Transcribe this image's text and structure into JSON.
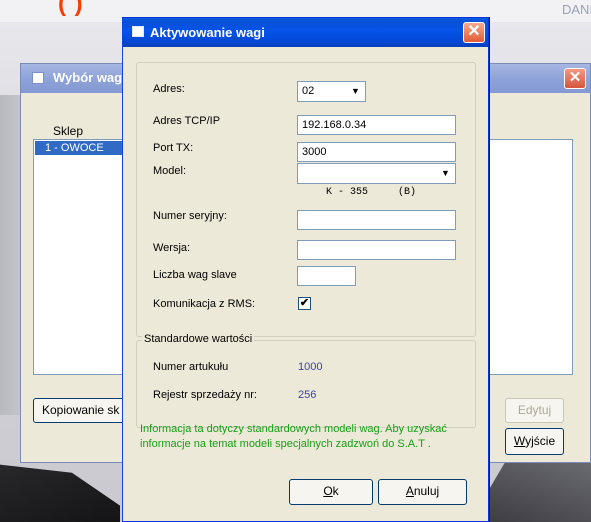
{
  "background": {
    "top_text": "(  )",
    "top_right_text": "DANI"
  },
  "back_window": {
    "title": "Wybór wag",
    "sklep_label": "Sklep",
    "sklep_items": [
      "1 - OWOCE"
    ],
    "buttons": {
      "kopiowanie": "Kopiowanie sk",
      "edytuj": "Edytuj",
      "wyjscie_first": "W",
      "wyjscie_rest": "yjście"
    }
  },
  "dialog": {
    "title": "Aktywowanie wagi",
    "fields": {
      "adres_label": "Adres:",
      "adres_value": "02",
      "tcpip_label": "Adres TCP/IP",
      "tcpip_value": "192.168.0.34",
      "porttx_label": "Port TX:",
      "porttx_value": "3000",
      "model_label": "Model:",
      "model_value": "K - 355     (B)",
      "serial_label": "Numer seryjny:",
      "serial_value": "",
      "wersja_label": "Wersja:",
      "wersja_value": "",
      "slave_label": "Liczba wag slave",
      "slave_value": "",
      "rms_label": "Komunikacja z  RMS:",
      "rms_checked": "✔"
    },
    "standard": {
      "legend": "Standardowe wartości",
      "artykul_label": "Numer artukułu",
      "artykul_value": "1000",
      "rejestr_label": "Rejestr sprzedaży nr:",
      "rejestr_value": "256"
    },
    "info": "Informacja ta dotyczy standardowych modeli wag. Aby uzyskać informacje na temat modeli specjalnych zadzwoń do  S.A.T .",
    "buttons": {
      "ok_first": "O",
      "ok_rest": "k",
      "anuluj_first": "A",
      "anuluj_rest": "nuluj"
    }
  }
}
